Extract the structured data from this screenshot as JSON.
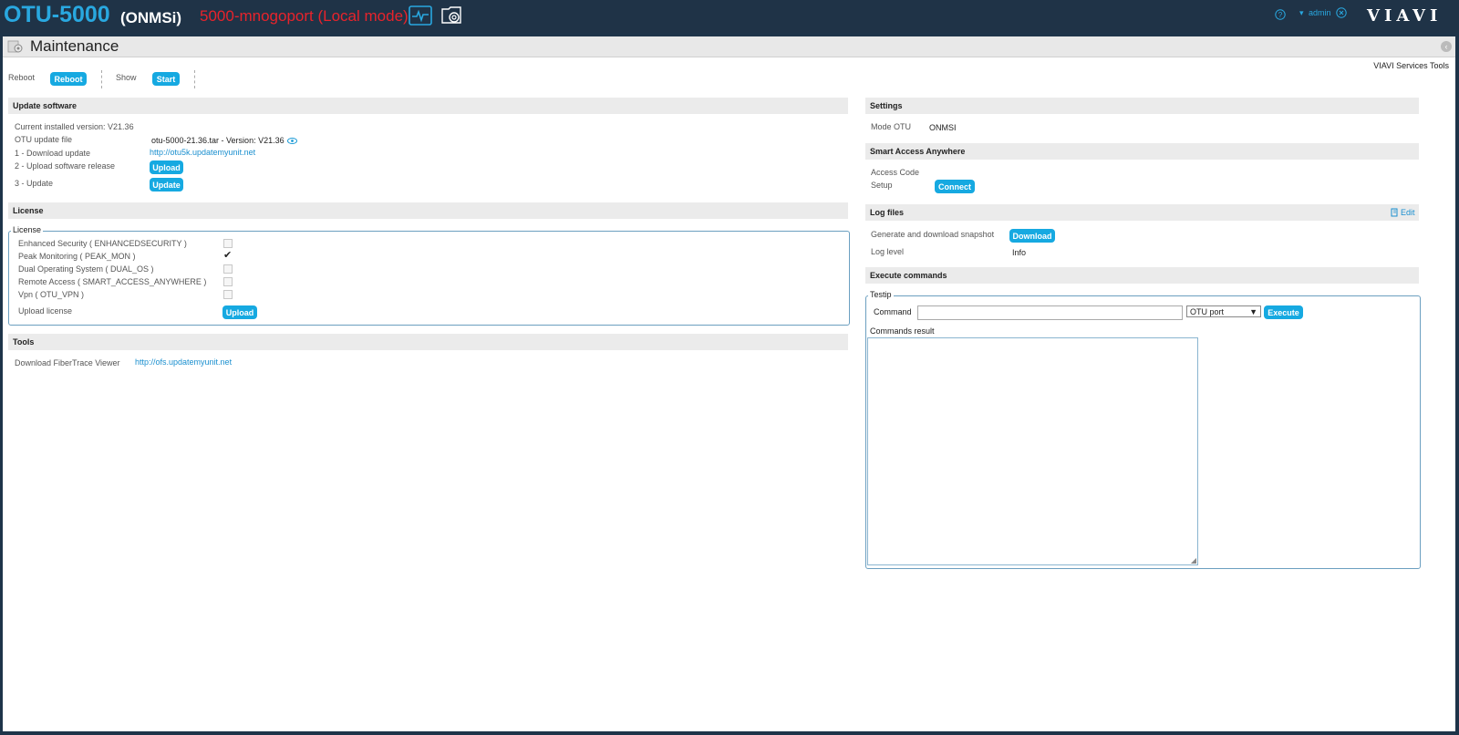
{
  "header": {
    "product": "OTU-5000",
    "mode": "(ONMSi)",
    "unit_name": "5000-mnogoport (Local mode)",
    "user": "admin",
    "logo": "VIAVI",
    "icons": [
      "monitor-icon",
      "settings-folder-icon",
      "help-icon",
      "logout-icon"
    ],
    "colors": {
      "brand": "#29a8e0",
      "unit_name": "#e8232b",
      "accent_button": "#16a9e1"
    }
  },
  "panel": {
    "title": "Maintenance",
    "services_link": "VIAVI Services Tools"
  },
  "toolbar": {
    "reboot_label": "Reboot",
    "reboot_button": "Reboot",
    "show_label": "Show",
    "start_button": "Start"
  },
  "update_software": {
    "title": "Update software",
    "current_version": "Current installed version: V21.36",
    "update_file_label": "OTU update file",
    "update_file_value": "otu-5000-21.36.tar - Version: V21.36",
    "download_label": "1 - Download update",
    "download_link": "http://otu5k.updatemyunit.net",
    "upload_label": "2 - Upload software release",
    "upload_button": "Upload",
    "update_label": "3 - Update",
    "update_button": "Update"
  },
  "license": {
    "title": "License",
    "legend": "License",
    "items": [
      {
        "label": "Enhanced Security ( ENHANCEDSECURITY )",
        "checked": false
      },
      {
        "label": "Peak Monitoring ( PEAK_MON )",
        "checked": true
      },
      {
        "label": "Dual Operating System ( DUAL_OS )",
        "checked": false
      },
      {
        "label": "Remote Access ( SMART_ACCESS_ANYWHERE )",
        "checked": false
      },
      {
        "label": "Vpn ( OTU_VPN )",
        "checked": false
      }
    ],
    "upload_label": "Upload license",
    "upload_button": "Upload"
  },
  "tools": {
    "title": "Tools",
    "viewer_label": "Download FiberTrace Viewer",
    "viewer_link": "http://ofs.updatemyunit.net"
  },
  "settings": {
    "title": "Settings",
    "mode_label": "Mode OTU",
    "mode_value": "ONMSI"
  },
  "smart_access": {
    "title": "Smart Access Anywhere",
    "code_label": "Access Code",
    "setup_label": "Setup",
    "connect_button": "Connect"
  },
  "log_files": {
    "title": "Log files",
    "edit_label": "Edit",
    "snapshot_label": "Generate and download snapshot",
    "download_button": "Download",
    "level_label": "Log level",
    "level_value": "Info"
  },
  "execute": {
    "title": "Execute commands",
    "legend": "Testip",
    "command_label": "Command",
    "command_value": "",
    "target_selected": "OTU port",
    "execute_button": "Execute",
    "result_label": "Commands result"
  }
}
